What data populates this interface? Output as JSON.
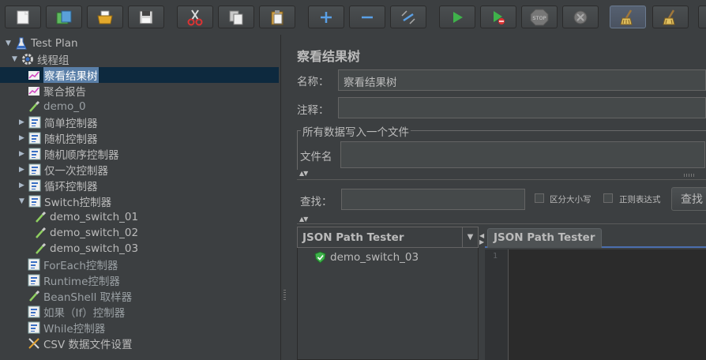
{
  "toolbar": {
    "buttons": [
      {
        "name": "new-icon"
      },
      {
        "name": "templates-icon"
      },
      {
        "name": "open-icon"
      },
      {
        "name": "save-icon"
      },
      {
        "name": "cut-icon"
      },
      {
        "name": "copy-icon"
      },
      {
        "name": "paste-icon"
      },
      {
        "name": "expand-icon"
      },
      {
        "name": "collapse-icon"
      },
      {
        "name": "toggle-icon"
      },
      {
        "name": "start-icon"
      },
      {
        "name": "start-no-pause-icon"
      },
      {
        "name": "stop-icon"
      },
      {
        "name": "shutdown-icon"
      },
      {
        "name": "clear-icon"
      },
      {
        "name": "clear-all-icon"
      }
    ],
    "stop_text": "STOP"
  },
  "tree": {
    "items": [
      {
        "label": "Test Plan"
      },
      {
        "label": "线程组"
      },
      {
        "label": "察看结果树"
      },
      {
        "label": "聚合报告"
      },
      {
        "label": "demo_0"
      },
      {
        "label": "简单控制器"
      },
      {
        "label": "随机控制器"
      },
      {
        "label": "随机顺序控制器"
      },
      {
        "label": "仅一次控制器"
      },
      {
        "label": "循环控制器"
      },
      {
        "label": "Switch控制器"
      },
      {
        "label": "demo_switch_01"
      },
      {
        "label": "demo_switch_02"
      },
      {
        "label": "demo_switch_03"
      },
      {
        "label": "ForEach控制器"
      },
      {
        "label": "Runtime控制器"
      },
      {
        "label": "BeanShell 取样器"
      },
      {
        "label": "如果（If）控制器"
      },
      {
        "label": "While控制器"
      },
      {
        "label": "CSV 数据文件设置"
      }
    ]
  },
  "panel": {
    "title": "察看结果树",
    "name_label": "名称：",
    "name_value": "察看结果树",
    "comment_label": "注释：",
    "comment_value": "",
    "file_section_legend": "所有数据写入一个文件",
    "filename_label": "文件名",
    "filename_value": "",
    "search_label": "查找：",
    "search_value": "",
    "case_sensitive_label": "区分大小写",
    "regex_label": "正则表达式",
    "search_button": "查找",
    "renderer_selected": "JSON Path Tester",
    "result_item": "demo_switch_03",
    "tab_label": "JSON Path Tester",
    "line_number": "1"
  },
  "colors": {
    "background": "#3c3f41",
    "selection": "#0d293e",
    "editor_bg": "#2b2b2b",
    "success_green": "#3fb24b",
    "stop_red": "#c0392b"
  }
}
